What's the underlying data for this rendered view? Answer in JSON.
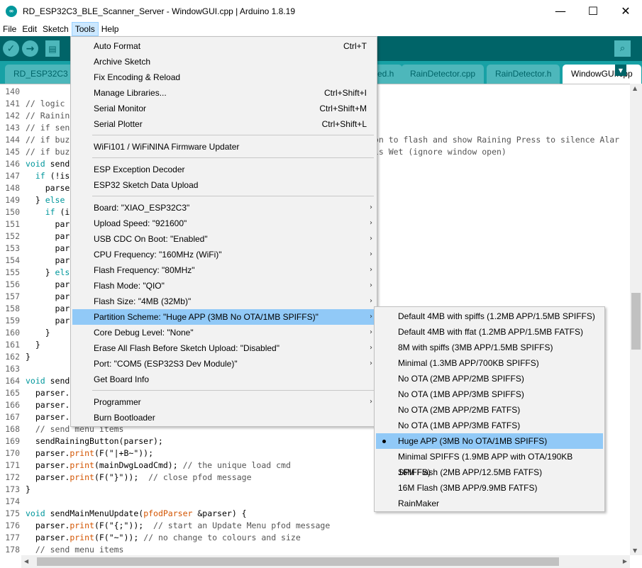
{
  "window": {
    "title": "RD_ESP32C3_BLE_Scanner_Server - WindowGUI.cpp | Arduino 1.8.19",
    "minimize_glyph": "—",
    "maximize_glyph": "☐",
    "close_glyph": "✕"
  },
  "menubar": {
    "items": [
      "File",
      "Edit",
      "Sketch",
      "Tools",
      "Help"
    ],
    "active": "Tools"
  },
  "toolbar": {
    "verify_glyph": "✓",
    "upload_glyph": "→",
    "new_glyph": "▤",
    "serial_glyph": "⌕"
  },
  "tabs": {
    "items": [
      "RD_ESP32C3",
      "ed.h",
      "RainDetector.cpp",
      "RainDetector.h",
      "WindowGUI.cpp"
    ],
    "active": "WindowGUI.cpp",
    "menu_glyph": "▼"
  },
  "editor": {
    "line_numbers": [
      "140",
      "141",
      "142",
      "143",
      "144",
      "145",
      "146",
      "147",
      "148",
      "149",
      "150",
      "151",
      "152",
      "153",
      "154",
      "155",
      "156",
      "157",
      "158",
      "159",
      "160",
      "161",
      "162",
      "163",
      "164",
      "165",
      "166",
      "167",
      "168",
      "169",
      "170",
      "171",
      "172",
      "173",
      "174",
      "175",
      "176",
      "177",
      "178"
    ],
    "visible_code": {
      "l141": "// logic",
      "l142": "// Raining",
      "l143": "// if sen",
      "l144": "// if buz",
      "l144_tail": "ton to flash and show Raining Press to silence Alar",
      "l145": "// if buz",
      "l145_tail": " is Wet (ignore window open)",
      "l146_kw": "void",
      "l146": " send",
      "l147_a": "  ",
      "l147_kw": "if",
      "l147_b": " (!is",
      "l148": "    parse",
      "l149_a": "  } ",
      "l149_kw": "else",
      "l150_a": "    ",
      "l150_kw": "if",
      "l150_b": " (i",
      "l151": "      par",
      "l152": "      par",
      "l153": "      par",
      "l154": "      par",
      "l155_a": "    } ",
      "l155_kw": "els",
      "l156": "      par",
      "l157": "      par",
      "l158": "      par",
      "l159": "      par",
      "l160": "    }",
      "l161": "  }",
      "l162": "}",
      "l163": "",
      "l164_kw": "void",
      "l164": " send",
      "l165": "  parser.",
      "l166": "  parser.",
      "l167": "  parser.",
      "l168": "  // send menu items",
      "l169": "  sendRainingButton(parser);",
      "l170_a": "  parser.",
      "l170_fn": "print",
      "l170_b": "(F(\"|+B~\"));",
      "l171_a": "  parser.",
      "l171_fn": "print",
      "l171_b": "(mainDwgLoadCmd); ",
      "l171_c": "// the unique load cmd",
      "l172_a": "  parser.",
      "l172_fn": "print",
      "l172_b": "(F(\"}\"));  ",
      "l172_c": "// close pfod message",
      "l173": "}",
      "l174": "",
      "l175_kw": "void",
      "l175_b": " sendMainMenuUpdate(",
      "l175_t": "pfodParser",
      "l175_c": " &parser) {",
      "l176_a": "  parser.",
      "l176_fn": "print",
      "l176_b": "(F(\"{;\"));  ",
      "l176_c": "// start an Update Menu pfod message",
      "l177_a": "  parser.",
      "l177_fn": "print",
      "l177_b": "(F(\"~\")); ",
      "l177_c": "// no change to colours and size",
      "l178": "  // send menu items"
    }
  },
  "tools_menu": {
    "items": [
      {
        "label": "Auto Format",
        "shortcut": "Ctrl+T"
      },
      {
        "label": "Archive Sketch",
        "shortcut": ""
      },
      {
        "label": "Fix Encoding & Reload",
        "shortcut": ""
      },
      {
        "label": "Manage Libraries...",
        "shortcut": "Ctrl+Shift+I"
      },
      {
        "label": "Serial Monitor",
        "shortcut": "Ctrl+Shift+M"
      },
      {
        "label": "Serial Plotter",
        "shortcut": "Ctrl+Shift+L"
      },
      {
        "label": "WiFi101 / WiFiNINA Firmware Updater",
        "shortcut": ""
      },
      {
        "label": "ESP Exception Decoder",
        "shortcut": ""
      },
      {
        "label": "ESP32 Sketch Data Upload",
        "shortcut": ""
      },
      {
        "label": "Board: \"XIAO_ESP32C3\"",
        "submenu": true
      },
      {
        "label": "Upload Speed: \"921600\"",
        "submenu": true
      },
      {
        "label": "USB CDC On Boot: \"Enabled\"",
        "submenu": true
      },
      {
        "label": "CPU Frequency: \"160MHz (WiFi)\"",
        "submenu": true
      },
      {
        "label": "Flash Frequency: \"80MHz\"",
        "submenu": true
      },
      {
        "label": "Flash Mode: \"QIO\"",
        "submenu": true
      },
      {
        "label": "Flash Size: \"4MB (32Mb)\"",
        "submenu": true
      },
      {
        "label": "Partition Scheme: \"Huge APP (3MB No OTA/1MB SPIFFS)\"",
        "submenu": true,
        "highlighted": true
      },
      {
        "label": "Core Debug Level: \"None\"",
        "submenu": true
      },
      {
        "label": "Erase All Flash Before Sketch Upload: \"Disabled\"",
        "submenu": true
      },
      {
        "label": "Port: \"COM5 (ESP32S3 Dev Module)\"",
        "submenu": true
      },
      {
        "label": "Get Board Info",
        "shortcut": ""
      },
      {
        "label": "Programmer",
        "submenu": true
      },
      {
        "label": "Burn Bootloader",
        "shortcut": ""
      }
    ],
    "submenu_arrow": "›"
  },
  "partition_submenu": {
    "items": [
      "Default 4MB with spiffs (1.2MB APP/1.5MB SPIFFS)",
      "Default 4MB with ffat (1.2MB APP/1.5MB FATFS)",
      "8M with spiffs (3MB APP/1.5MB SPIFFS)",
      "Minimal (1.3MB APP/700KB SPIFFS)",
      "No OTA (2MB APP/2MB SPIFFS)",
      "No OTA (1MB APP/3MB SPIFFS)",
      "No OTA (2MB APP/2MB FATFS)",
      "No OTA (1MB APP/3MB FATFS)",
      "Huge APP (3MB No OTA/1MB SPIFFS)",
      "Minimal SPIFFS (1.9MB APP with OTA/190KB SPIFFS)",
      "16M Flash (2MB APP/12.5MB FATFS)",
      "16M Flash (3MB APP/9.9MB FATFS)",
      "RainMaker"
    ],
    "selected": "Huge APP (3MB No OTA/1MB SPIFFS)"
  },
  "colors": {
    "teal_dark": "#006468",
    "teal_mid": "#17a1a5",
    "teal_light": "#4db7bb",
    "highlight": "#91c9f7"
  }
}
